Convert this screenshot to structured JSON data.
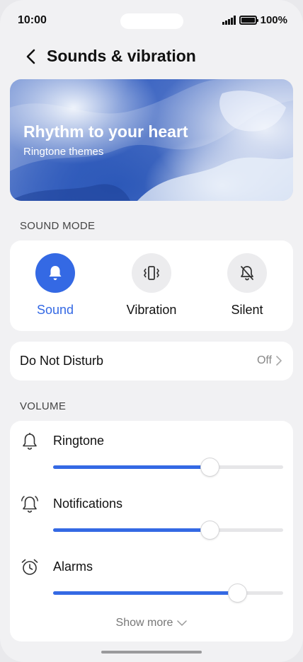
{
  "status_bar": {
    "time": "10:00",
    "battery": "100%"
  },
  "header": {
    "title": "Sounds & vibration"
  },
  "banner": {
    "title": "Rhythm to your heart",
    "subtitle": "Ringtone themes"
  },
  "sound_mode": {
    "section_label": "SOUND MODE",
    "modes": [
      {
        "label": "Sound",
        "icon": "bell-icon",
        "selected": true
      },
      {
        "label": "Vibration",
        "icon": "vibration-icon",
        "selected": false
      },
      {
        "label": "Silent",
        "icon": "bell-off-icon",
        "selected": false
      }
    ]
  },
  "do_not_disturb": {
    "label": "Do Not Disturb",
    "value": "Off"
  },
  "volume": {
    "section_label": "VOLUME",
    "items": [
      {
        "label": "Ringtone",
        "icon": "bell-outline-icon",
        "level": 0.68
      },
      {
        "label": "Notifications",
        "icon": "notification-bell-icon",
        "level": 0.68
      },
      {
        "label": "Alarms",
        "icon": "alarm-clock-icon",
        "level": 0.8
      }
    ],
    "show_more": "Show more"
  },
  "colors": {
    "accent": "#3469e4",
    "background": "#f1f1f3",
    "card": "#ffffff"
  }
}
